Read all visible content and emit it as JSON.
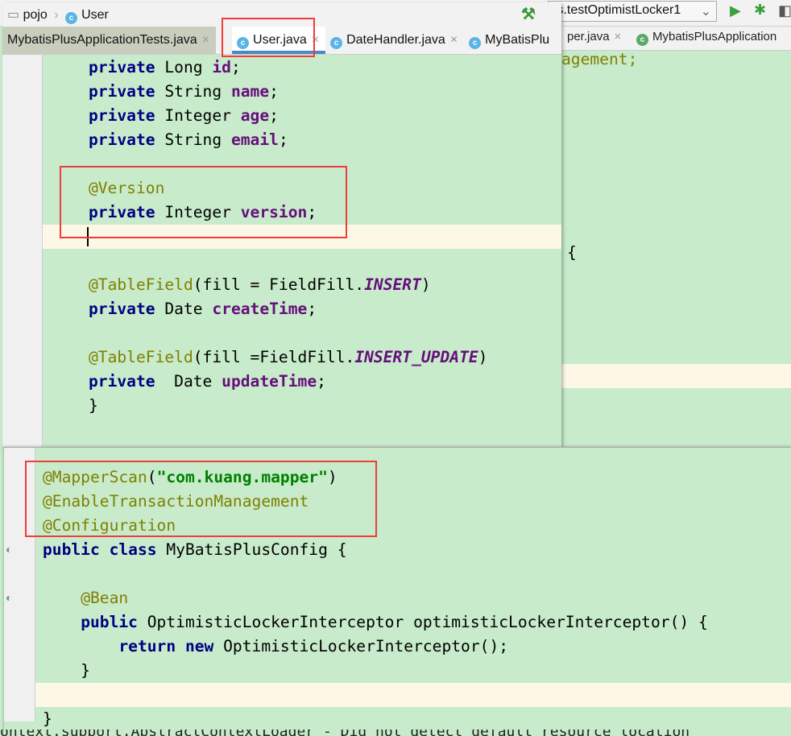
{
  "background_window": {
    "run_config": "ts.testOptimistLocker1",
    "tabs": [
      "per.java",
      "MybatisPlusApplication"
    ],
    "code_fragments": [
      "agement;",
      "{"
    ],
    "log_line": "ontext.support.AbstractContextLoader - Did not detect default resource location"
  },
  "user_editor": {
    "breadcrumb": [
      "pojo",
      "User"
    ],
    "tabs": [
      {
        "label": "MybatisPlusApplicationTests.java",
        "active": false
      },
      {
        "label": "User.java",
        "active": true
      },
      {
        "label": "DateHandler.java",
        "active": false
      },
      {
        "label": "MyBatisPlu",
        "active": false
      }
    ],
    "code": [
      [
        [
          "kw",
          "private "
        ],
        [
          "pl",
          "Long "
        ],
        [
          "fd",
          "id"
        ],
        [
          "pl",
          ";"
        ]
      ],
      [
        [
          "kw",
          "private "
        ],
        [
          "pl",
          "String "
        ],
        [
          "fd",
          "name"
        ],
        [
          "pl",
          ";"
        ]
      ],
      [
        [
          "kw",
          "private "
        ],
        [
          "pl",
          "Integer "
        ],
        [
          "fd",
          "age"
        ],
        [
          "pl",
          ";"
        ]
      ],
      [
        [
          "kw",
          "private "
        ],
        [
          "pl",
          "String "
        ],
        [
          "fd",
          "email"
        ],
        [
          "pl",
          ";"
        ]
      ],
      [],
      [
        [
          "an",
          "@Version"
        ]
      ],
      [
        [
          "kw",
          "private "
        ],
        [
          "pl",
          "Integer "
        ],
        [
          "fd",
          "version"
        ],
        [
          "pl",
          ";"
        ]
      ],
      [],
      [],
      [
        [
          "an",
          "@TableField"
        ],
        [
          "pl",
          "(fill = FieldFill."
        ],
        [
          "si",
          "INSERT"
        ],
        [
          "pl",
          ")"
        ]
      ],
      [
        [
          "kw",
          "private "
        ],
        [
          "pl",
          "Date "
        ],
        [
          "fd",
          "createTime"
        ],
        [
          "pl",
          ";"
        ]
      ],
      [],
      [
        [
          "an",
          "@TableField"
        ],
        [
          "pl",
          "(fill =FieldFill."
        ],
        [
          "si",
          "INSERT_UPDATE"
        ],
        [
          "pl",
          ")"
        ]
      ],
      [
        [
          "kw",
          "private  "
        ],
        [
          "pl",
          "Date "
        ],
        [
          "fd",
          "updateTime"
        ],
        [
          "pl",
          ";"
        ]
      ],
      [
        [
          "pl",
          "}"
        ]
      ]
    ]
  },
  "config_editor": {
    "code": [
      [
        [
          "an",
          "@MapperScan"
        ],
        [
          "pl",
          "("
        ],
        [
          "st",
          "\"com.kuang.mapper\""
        ],
        [
          "pl",
          ")"
        ]
      ],
      [
        [
          "an",
          "@EnableTransactionManagement"
        ]
      ],
      [
        [
          "an",
          "@Configuration"
        ]
      ],
      [
        [
          "kw",
          "public class "
        ],
        [
          "pl",
          "MyBatisPlusConfig {"
        ]
      ],
      [],
      [
        [
          "pl",
          "    "
        ],
        [
          "an",
          "@Bean"
        ]
      ],
      [
        [
          "pl",
          "    "
        ],
        [
          "kw",
          "public "
        ],
        [
          "pl",
          "OptimisticLockerInterceptor optimisticLockerInterceptor() {"
        ]
      ],
      [
        [
          "pl",
          "        "
        ],
        [
          "kw",
          "return new "
        ],
        [
          "pl",
          "OptimisticLockerInterceptor();"
        ]
      ],
      [
        [
          "pl",
          "    }"
        ]
      ],
      [],
      [
        [
          "pl",
          "}"
        ]
      ]
    ]
  },
  "colors": {
    "highlight_box": "#f03c3c",
    "editor_bg": "#c7ebcb",
    "current_line": "#fdf8e6",
    "active_tab_underline": "#4a88c7"
  }
}
